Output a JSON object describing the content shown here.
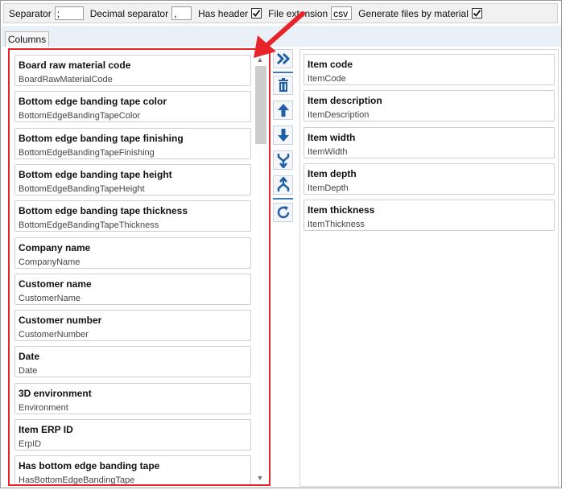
{
  "toolbar": {
    "separator_label": "Separator",
    "separator_value": ";",
    "decimal_label": "Decimal separator",
    "decimal_value": ",",
    "has_header_label": "Has header",
    "has_header_checked": true,
    "file_ext_label": "File extension",
    "file_ext_value": "csv",
    "gen_files_label": "Generate files by material",
    "gen_files_checked": true
  },
  "tabs": [
    {
      "label": "Columns",
      "active": true
    }
  ],
  "available_columns": [
    {
      "title": "Board raw material code",
      "code": "BoardRawMaterialCode"
    },
    {
      "title": "Bottom edge banding tape color",
      "code": "BottomEdgeBandingTapeColor"
    },
    {
      "title": "Bottom edge banding tape finishing",
      "code": "BottomEdgeBandingTapeFinishing"
    },
    {
      "title": "Bottom edge banding tape height",
      "code": "BottomEdgeBandingTapeHeight"
    },
    {
      "title": "Bottom edge banding tape thickness",
      "code": "BottomEdgeBandingTapeThickness"
    },
    {
      "title": "Company name",
      "code": "CompanyName"
    },
    {
      "title": "Customer name",
      "code": "CustomerName"
    },
    {
      "title": "Customer number",
      "code": "CustomerNumber"
    },
    {
      "title": "Date",
      "code": "Date"
    },
    {
      "title": "3D environment",
      "code": "Environment"
    },
    {
      "title": "Item ERP ID",
      "code": "ErpID"
    },
    {
      "title": "Has bottom edge banding tape",
      "code": "HasBottomEdgeBandingTape"
    }
  ],
  "selected_columns": [
    {
      "title": "Item code",
      "code": "ItemCode"
    },
    {
      "title": "Item description",
      "code": "ItemDescription"
    },
    {
      "title": "Item width",
      "code": "ItemWidth"
    },
    {
      "title": "Item depth",
      "code": "ItemDepth"
    },
    {
      "title": "Item thickness",
      "code": "ItemThickness"
    }
  ],
  "tool_buttons": [
    {
      "name": "add-all-button",
      "icon": "double-chevron-right-icon"
    },
    {
      "name": "delete-button",
      "icon": "trash-icon"
    },
    {
      "name": "move-up-button",
      "icon": "arrow-up-icon"
    },
    {
      "name": "move-down-button",
      "icon": "arrow-down-icon"
    },
    {
      "name": "move-to-bottom-button",
      "icon": "merge-down-icon"
    },
    {
      "name": "move-to-top-button",
      "icon": "split-up-icon"
    },
    {
      "name": "reset-button",
      "icon": "refresh-icon"
    }
  ],
  "colors": {
    "highlight_border": "#e8242b",
    "annotation_arrow": "#e8242b",
    "button_icon": "#1f5fa8",
    "tab_strip": "#e9f0f8"
  }
}
